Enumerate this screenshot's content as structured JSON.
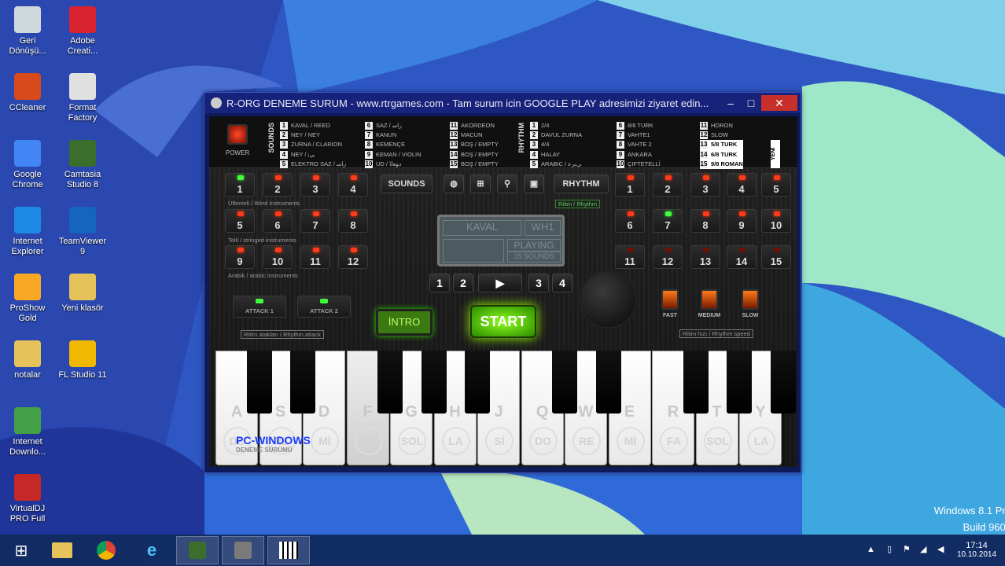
{
  "desktop": {
    "icons": [
      {
        "name": "recycle-bin",
        "l1": "Geri",
        "l2": "Dönüşü...",
        "c": "#cfd8dc"
      },
      {
        "name": "adobe-creative",
        "l1": "Adobe",
        "l2": "Creati...",
        "c": "#d9232e"
      },
      {
        "name": "ccleaner",
        "l1": "CCleaner",
        "l2": "",
        "c": "#d84a1c"
      },
      {
        "name": "format-factory",
        "l1": "Format",
        "l2": "Factory",
        "c": "#e0e0e0"
      },
      {
        "name": "google-chrome",
        "l1": "Google",
        "l2": "Chrome",
        "c": "#4285f4"
      },
      {
        "name": "camtasia",
        "l1": "Camtasia",
        "l2": "Studio 8",
        "c": "#3a6e2a"
      },
      {
        "name": "internet-explorer",
        "l1": "Internet",
        "l2": "Explorer",
        "c": "#1e88e5"
      },
      {
        "name": "teamviewer",
        "l1": "TeamViewer",
        "l2": "9",
        "c": "#1565c0"
      },
      {
        "name": "proshow-gold",
        "l1": "ProShow",
        "l2": "Gold",
        "c": "#f9a825"
      },
      {
        "name": "yeni-klasor",
        "l1": "Yeni klasör",
        "l2": "",
        "c": "#e6c25a"
      },
      {
        "name": "notalar",
        "l1": "notalar",
        "l2": "",
        "c": "#e6c25a"
      },
      {
        "name": "fl-studio",
        "l1": "FL Studio 11",
        "l2": "",
        "c": "#f0b800"
      },
      {
        "name": "internet-download",
        "l1": "Internet",
        "l2": "Downlo...",
        "c": "#43a047"
      },
      {
        "name": "virtualdj",
        "l1": "VirtualDJ",
        "l2": "PRO Full",
        "c": "#c62828"
      }
    ],
    "watermark1": "Windows 8.1 Pro",
    "watermark2": "Build 9600"
  },
  "window": {
    "title": "R-ORG DENEME SURUM - www.rtrgames.com - Tam surum icin GOOGLE PLAY adresimizi ziyaret edin...",
    "min": "–",
    "max": "□",
    "close": "✕"
  },
  "app": {
    "power": "POWER",
    "sounds_v": "SOUNDS",
    "rhythm_v": "RHYTHM",
    "yeni": "YENİ",
    "sounds_list": [
      [
        "1",
        "KAVAL / REED"
      ],
      [
        "2",
        "NEY / NEY"
      ],
      [
        "3",
        "ZURNA / CLARION"
      ],
      [
        "4",
        "NEY / ﻲﻧ"
      ],
      [
        "5",
        "ELEKTRO SAZ / ﺯﺎﺳ"
      ],
      [
        "6",
        "SAZ / ﺯﺎﺳ"
      ],
      [
        "7",
        "KANUN"
      ],
      [
        "8",
        "KEMENÇE"
      ],
      [
        "9",
        "KEMAN / VIOLIN"
      ],
      [
        "10",
        "UD / ﺩﻮﻌﻟﺍ"
      ],
      [
        "11",
        "AKORDEON"
      ],
      [
        "12",
        "MACUN"
      ],
      [
        "13",
        "BOŞ / EMPTY"
      ],
      [
        "14",
        "BOŞ / EMPTY"
      ],
      [
        "15",
        "BOŞ / EMPTY"
      ]
    ],
    "rhythm_list": [
      [
        "1",
        "2/4"
      ],
      [
        "2",
        "DAVUL ZURNA"
      ],
      [
        "3",
        "4/4"
      ],
      [
        "4",
        "HALAY"
      ],
      [
        "5",
        "ARABIC / ﻲﺑﺮﻋ"
      ],
      [
        "6",
        "8/8 TURK"
      ],
      [
        "7",
        "VAHTE1"
      ],
      [
        "8",
        "VAHTE 2"
      ],
      [
        "9",
        "ANKARA"
      ],
      [
        "10",
        "ÇIFTETELLİ"
      ],
      [
        "11",
        "HORON"
      ],
      [
        "12",
        "SLOW"
      ],
      [
        "13",
        "5/8 TURK"
      ],
      [
        "14",
        "6/8 TURK"
      ],
      [
        "15",
        "9/8 ROMAN"
      ]
    ],
    "sound_pads": [
      "1",
      "2",
      "3",
      "4",
      "5",
      "6",
      "7",
      "8",
      "9",
      "10",
      "11",
      "12"
    ],
    "rhythm_pads": [
      "1",
      "2",
      "3",
      "4",
      "5",
      "6",
      "7",
      "8",
      "9",
      "10",
      "11",
      "12",
      "13",
      "14",
      "15"
    ],
    "sounds_btn": "SOUNDS",
    "rhythm_btn": "RHYTHM",
    "rhythm_tag": "Ritim / Rhythm",
    "cat1": "Üflemeli / Wind instruments",
    "cat2": "Telli / stringed instruments",
    "cat3": "Arabik / arabic instruments",
    "lcd_sound": "KAVAL",
    "lcd_code": "WH1",
    "lcd_status": "PLAYING",
    "lcd_sub": "15 SOUNDS",
    "nums": [
      "1",
      "2",
      "3",
      "4"
    ],
    "play": "▶",
    "attack1": "ATTACK 1",
    "attack2": "ATTACK 2",
    "attack_label": "Ritim atakları / Rhythm attack",
    "intro": "İNTRO",
    "start": "START",
    "fast": "FAST",
    "medium": "MEDIUM",
    "slow": "SLOW",
    "speed_label": "Ritim hızı / Rhythm speed",
    "keys": [
      [
        "A",
        "DO"
      ],
      [
        "S",
        "RE"
      ],
      [
        "D",
        "Mİ"
      ],
      [
        "F",
        "FA"
      ],
      [
        "G",
        "SOL"
      ],
      [
        "H",
        "LA"
      ],
      [
        "J",
        "Sİ"
      ],
      [
        "Q",
        "DO"
      ],
      [
        "W",
        "RE"
      ],
      [
        "E",
        "Mİ"
      ],
      [
        "R",
        "FA"
      ],
      [
        "T",
        "SOL"
      ],
      [
        "Y",
        "LA"
      ]
    ],
    "brand1": "PC-WINDOWS",
    "brand2": "DENEME SÜRÜMÜ"
  },
  "taskbar": {
    "time": "17:14",
    "date": "10.10.2014"
  }
}
